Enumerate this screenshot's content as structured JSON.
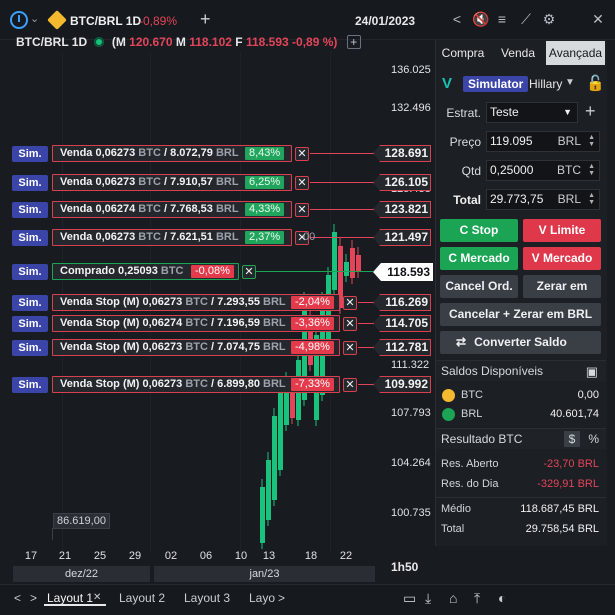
{
  "topbar": {
    "symbol": "BTC/BRL 1D",
    "change": "-0,89%",
    "plus": "+",
    "date": "24/01/2023",
    "icons": [
      "share-icon",
      "mute-icon",
      "settings-sliders-icon",
      "chart-icon",
      "gear-icon",
      "close-icon"
    ]
  },
  "info": {
    "symbol": "BTC/BRL 1D",
    "open_paren": "(",
    "m1_label": "M",
    "m1_value": "120.670",
    "m2_label": "M",
    "m2_value": "118.102",
    "f_label": "F",
    "f_value": "118.593",
    "change": "-0,89 %)",
    "add": "+"
  },
  "chart": {
    "y_labels": [
      "136.025",
      "132.496",
      "125.438",
      "111.322",
      "107.793",
      "104.264",
      "100.735"
    ],
    "x_labels": [
      "17",
      "21",
      "25",
      "29",
      "02",
      "06",
      "10",
      "13",
      "18",
      "22"
    ],
    "months": [
      "dez/22",
      "jan/23"
    ],
    "prev_tooltip": "86.619,00",
    "zoom": "1h50",
    "current_price": "118.593",
    "ghost_label": "00",
    "orders": [
      {
        "sim": "Sim.",
        "text": "Venda 0,06273",
        "unit1": "BTC",
        "sep": "/",
        "value": "8.072,79",
        "unit2": "BRL",
        "pct": "8,43%",
        "pct_type": "g",
        "price": "128.691"
      },
      {
        "sim": "Sim.",
        "text": "Venda 0,06273",
        "unit1": "BTC",
        "sep": "/",
        "value": "7.910,57",
        "unit2": "BRL",
        "pct": "6,25%",
        "pct_type": "g",
        "price": "126.105"
      },
      {
        "sim": "Sim.",
        "text": "Venda 0,06274",
        "unit1": "BTC",
        "sep": "/",
        "value": "7.768,53",
        "unit2": "BRL",
        "pct": "4,33%",
        "pct_type": "g",
        "price": "123.821"
      },
      {
        "sim": "Sim.",
        "text": "Venda 0,06273",
        "unit1": "BTC",
        "sep": "/",
        "value": "7.621,51",
        "unit2": "BRL",
        "pct": "2,37%",
        "pct_type": "g",
        "price": "121.497"
      },
      {
        "sim": "Sim.",
        "text": "Venda Stop (M) 0,06273",
        "unit1": "BTC",
        "sep": "/",
        "value": "7.293,55",
        "unit2": "BRL",
        "pct": "-2,04%",
        "pct_type": "r",
        "price": "116.269"
      },
      {
        "sim": "Sim.",
        "text": "Venda Stop (M) 0,06274",
        "unit1": "BTC",
        "sep": "/",
        "value": "7.196,59",
        "unit2": "BRL",
        "pct": "-3,36%",
        "pct_type": "r",
        "price": "114.705"
      },
      {
        "sim": "Sim.",
        "text": "Venda Stop (M) 0,06273",
        "unit1": "BTC",
        "sep": "/",
        "value": "7.074,75",
        "unit2": "BRL",
        "pct": "-4,98%",
        "pct_type": "r",
        "price": "112.781"
      },
      {
        "sim": "Sim.",
        "text": "Venda Stop (M) 0,06273",
        "unit1": "BTC",
        "sep": "/",
        "value": "6.899,80",
        "unit2": "BRL",
        "pct": "-7,33%",
        "pct_type": "r",
        "price": "109.992"
      }
    ],
    "position": {
      "sim": "Sim.",
      "text": "Comprado 0,25093",
      "unit": "BTC",
      "pct": "-0,08%"
    },
    "close_glyph": "✕"
  },
  "panel": {
    "tabs": [
      "Compra",
      "Venda",
      "Avançada"
    ],
    "simulator": "Simulator",
    "account": "Hillary",
    "estrat_label": "Estrat.",
    "estrat_value": "Teste",
    "preco_label": "Preço",
    "preco_value": "119.095",
    "preco_unit": "BRL",
    "qtd_label": "Qtd",
    "qtd_value": "0,25000",
    "qtd_unit": "BTC",
    "total_label": "Total",
    "total_value": "29.773,75",
    "total_unit": "BRL",
    "buttons": {
      "c_stop": "C Stop",
      "v_limite": "V Limite",
      "c_mercado": "C Mercado",
      "v_mercado": "V Mercado",
      "cancel_ord": "Cancel Ord.",
      "zerar_brl": "Zerar em BRL",
      "cancelar_zerar": "Cancelar + Zerar em BRL",
      "converter": "Converter Saldo"
    },
    "saldos_title": "Saldos Disponíveis",
    "balances": [
      {
        "asset": "BTC",
        "value": "0,00"
      },
      {
        "asset": "BRL",
        "value": "40.601,74"
      }
    ],
    "resultado_title": "Resultado BTC",
    "resultado_dollar": "$",
    "resultado_pct": "%",
    "results": [
      {
        "label": "Res. Aberto",
        "value": "-23,70 BRL"
      },
      {
        "label": "Res. do Dia",
        "value": "-329,91 BRL"
      }
    ],
    "summary": [
      {
        "label": "Médio",
        "value": "118.687,45 BRL"
      },
      {
        "label": "Total",
        "value": "29.758,54 BRL"
      }
    ]
  },
  "bottom": {
    "tabs": [
      "Layout 1",
      "Layout 2",
      "Layout 3",
      "Layo"
    ],
    "close": "✕",
    "prev": "<",
    "next": ">"
  },
  "colors": {
    "accent": "#3b45a8",
    "green": "#1aa454",
    "red": "#e0384b",
    "candle_up": "#19c37d",
    "candle_down": "#e2455a"
  }
}
